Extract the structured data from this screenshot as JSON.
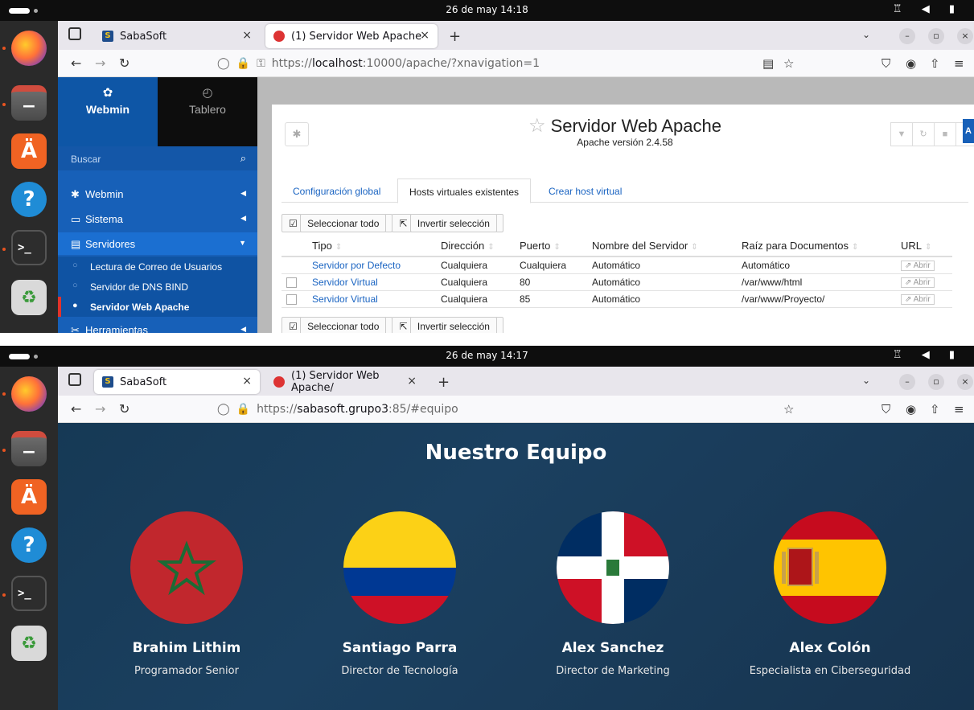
{
  "screens": [
    {
      "topbar": {
        "clock": "26 de may  14:18",
        "status_icons": "♖ ◀ ▮"
      },
      "browser": {
        "tabs": [
          {
            "label": "SabaSoft",
            "active": false
          },
          {
            "label": "(1) Servidor Web Apache",
            "active": true
          }
        ],
        "new_tab": "+",
        "url_prefix": "https://",
        "url_host": "localhost",
        "url_rest": ":10000/apache/?xnavigation=1"
      },
      "webmin": {
        "sidebar": {
          "tab_webmin": "Webmin",
          "tab_tablero": "Tablero",
          "search_placeholder": "Buscar",
          "items": [
            {
              "label": "Webmin"
            },
            {
              "label": "Sistema"
            },
            {
              "label": "Servidores"
            }
          ],
          "sub_items": [
            {
              "label": "Lectura de Correo de Usuarios"
            },
            {
              "label": "Servidor de DNS BIND"
            },
            {
              "label": "Servidor Web Apache"
            }
          ],
          "next_item": "Herramientas"
        },
        "title": "Servidor Web Apache",
        "subtitle": "Apache versión 2.4.58",
        "tabs": [
          {
            "label": "Configuración global"
          },
          {
            "label": "Hosts virtuales existentes"
          },
          {
            "label": "Crear host virtual"
          }
        ],
        "select_all": "Seleccionar todo",
        "invert_selection": "Invertir selección",
        "table": {
          "headers": [
            "Tipo",
            "Dirección",
            "Puerto",
            "Nombre del Servidor",
            "Raíz para Documentos",
            "URL"
          ],
          "rows": [
            {
              "tipo": "Servidor por Defecto",
              "direccion": "Cualquiera",
              "puerto": "Cualquiera",
              "nombre": "Automático",
              "raiz": "Automático",
              "url": "Abrir"
            },
            {
              "tipo": "Servidor Virtual",
              "direccion": "Cualquiera",
              "puerto": "80",
              "nombre": "Automático",
              "raiz": "/var/www/html",
              "url": "Abrir"
            },
            {
              "tipo": "Servidor Virtual",
              "direccion": "Cualquiera",
              "puerto": "85",
              "nombre": "Automático",
              "raiz": "/var/www/Proyecto/",
              "url": "Abrir"
            }
          ]
        }
      }
    },
    {
      "topbar": {
        "clock": "26 de may  14:17",
        "status_icons": "♖ ◀ ▮"
      },
      "browser": {
        "tabs": [
          {
            "label": "SabaSoft",
            "active": true
          },
          {
            "label": "(1) Servidor Web Apache/",
            "active": false
          }
        ],
        "new_tab": "+",
        "url_prefix": "https://",
        "url_host": "sabasoft.grupo3",
        "url_rest": ":85/#equipo"
      },
      "site": {
        "title": "Nuestro Equipo",
        "members": [
          {
            "name": "Brahim Lithim",
            "role": "Programador Senior"
          },
          {
            "name": "Santiago Parra",
            "role": "Director de Tecnología"
          },
          {
            "name": "Alex Sanchez",
            "role": "Director de Marketing"
          },
          {
            "name": "Alex Colón",
            "role": "Especialista en Ciberseguridad"
          }
        ]
      }
    }
  ],
  "colors": {
    "webmin_sidebar": "#1760b8",
    "webmin_link": "#1a64c2",
    "site_background": "#1b4060"
  }
}
